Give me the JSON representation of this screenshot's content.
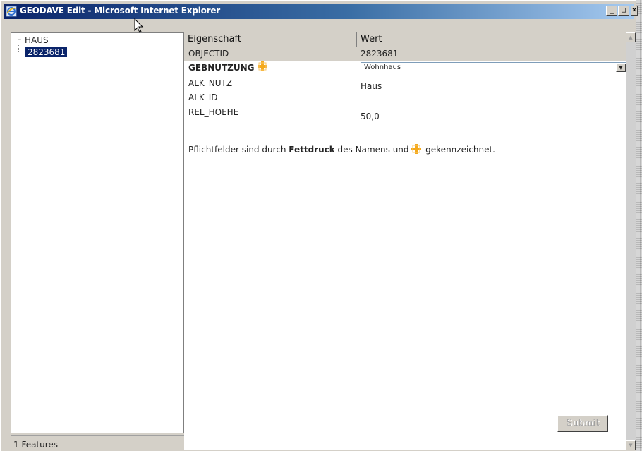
{
  "window": {
    "title": "GEODAVE Edit - Microsoft Internet Explorer",
    "min_label": "_",
    "max_label": "□",
    "close_label": "×"
  },
  "tree": {
    "root_expander": "−",
    "root_label": "HAUS",
    "child_label": "2823681"
  },
  "status": {
    "features": "1 Features"
  },
  "table": {
    "header_property": "Eigenschaft",
    "header_value": "Wert",
    "rows": [
      {
        "name": "OBJECTID",
        "value": "2823681"
      },
      {
        "name": "GEBNUTZUNG",
        "value": "Wohnhaus"
      },
      {
        "name": "ALK_NUTZ",
        "value": "Haus"
      },
      {
        "name": "ALK_ID",
        "value": ""
      },
      {
        "name": "REL_HOEHE",
        "value": "50,0"
      }
    ]
  },
  "note": {
    "part1": "Pflichtfelder sind durch ",
    "bold": "Fettdruck",
    "part2": " des Namens und ",
    "part3": " gekennzeichnet."
  },
  "form": {
    "submit_label": "Submit"
  },
  "icons": {
    "app": "ie-icon",
    "required": "required-marker-icon",
    "dropdown": "chevron-down-icon"
  },
  "colors": {
    "titlebar_start": "#0a246a",
    "selection": "#0a246a",
    "required_marker": "#f4a91c",
    "panel_gray": "#d4d0c8"
  }
}
